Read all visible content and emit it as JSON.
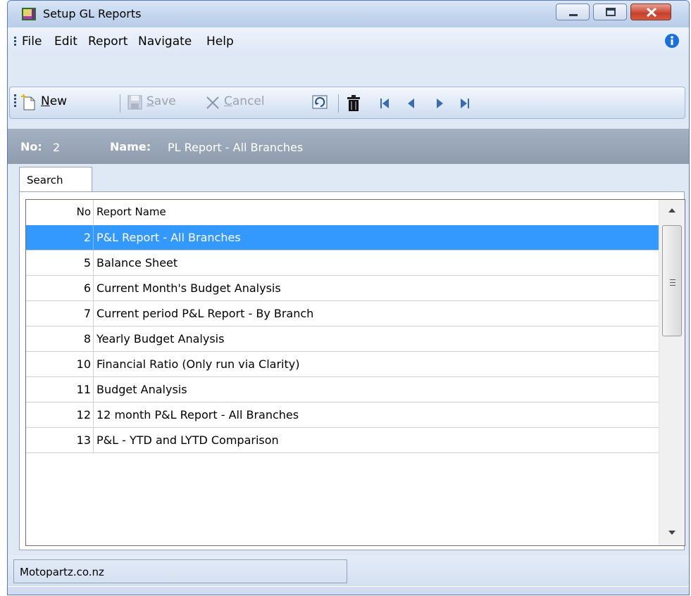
{
  "window": {
    "title": "Setup GL Reports"
  },
  "menu": {
    "items": [
      "File",
      "Edit",
      "Report",
      "Navigate",
      "Help"
    ]
  },
  "toolbar": {
    "new_label": "New",
    "new_underline": "N",
    "new_rest": "ew",
    "save_underline": "S",
    "save_rest": "ave",
    "cancel_underline": "C",
    "cancel_rest": "ancel"
  },
  "record": {
    "no_label": "No:",
    "no_value": "2",
    "name_label": "Name:",
    "name_value": "PL Report - All Branches"
  },
  "tabs": [
    {
      "label": "Search"
    }
  ],
  "grid": {
    "columns": [
      "No",
      "Report Name"
    ],
    "rows": [
      {
        "no": "2",
        "name": "P&L Report - All Branches",
        "selected": true
      },
      {
        "no": "5",
        "name": "Balance Sheet"
      },
      {
        "no": "6",
        "name": "Current Month's Budget Analysis"
      },
      {
        "no": "7",
        "name": "Current period P&L Report - By Branch"
      },
      {
        "no": "8",
        "name": "Yearly Budget Analysis"
      },
      {
        "no": "10",
        "name": "Financial Ratio (Only run via Clarity)"
      },
      {
        "no": "11",
        "name": "Budget Analysis"
      },
      {
        "no": "12",
        "name": "12 month P&L Report - All Branches"
      },
      {
        "no": "13",
        "name": "P&L - YTD and LYTD Comparison"
      }
    ]
  },
  "status": {
    "text": "Motopartz.co.nz"
  },
  "colors": {
    "selection": "#3399ff",
    "header_strip": "#98a6b8"
  }
}
